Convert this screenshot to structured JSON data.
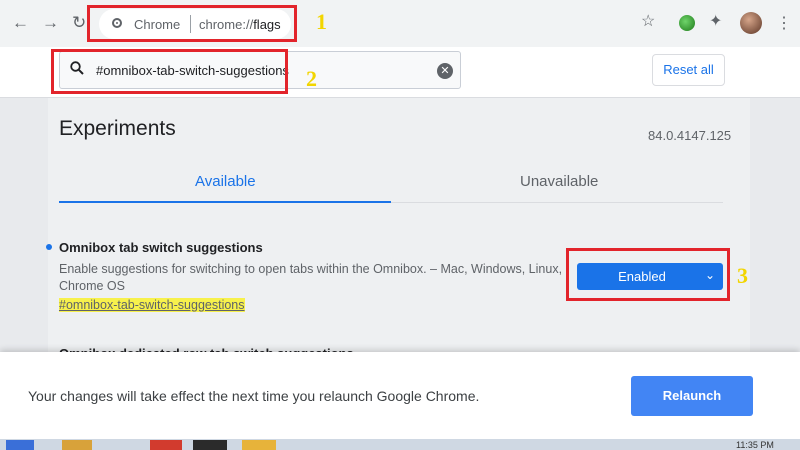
{
  "browser": {
    "site_chip": "Chrome",
    "url_host": "chrome://",
    "url_path": "flags",
    "back_icon": "arrow-left-icon",
    "forward_icon": "arrow-right-icon",
    "reload_icon": "reload-icon",
    "star_icon": "star-icon",
    "extensions_icon": "puzzle-icon",
    "menu_icon": "kebab-icon"
  },
  "flags_header": {
    "search_value": "#omnibox-tab-switch-suggestions",
    "reset_label": "Reset all"
  },
  "main": {
    "title": "Experiments",
    "version": "84.0.4147.125",
    "tabs": [
      {
        "label": "Available",
        "active": true
      },
      {
        "label": "Unavailable",
        "active": false
      }
    ]
  },
  "experiment": {
    "name": "Omnibox tab switch suggestions",
    "description": "Enable suggestions for switching to open tabs within the Omnibox. – Mac, Windows, Linux, Chrome OS",
    "link": "#omnibox-tab-switch-suggestions",
    "selected": "Enabled"
  },
  "next_experiment": {
    "name": "Omnibox dedicated row tab switch suggestions"
  },
  "relaunch_bar": {
    "message": "Your changes will take effect the next time you relaunch Google Chrome.",
    "button": "Relaunch"
  },
  "taskbar": {
    "clock": "11:35 PM"
  },
  "annotations": [
    "1",
    "2",
    "3"
  ],
  "colors": {
    "accent": "#1a73e8",
    "annotation_box": "#e2242b",
    "annotation_number": "#f2d500",
    "highlight": "#f7f14c"
  }
}
